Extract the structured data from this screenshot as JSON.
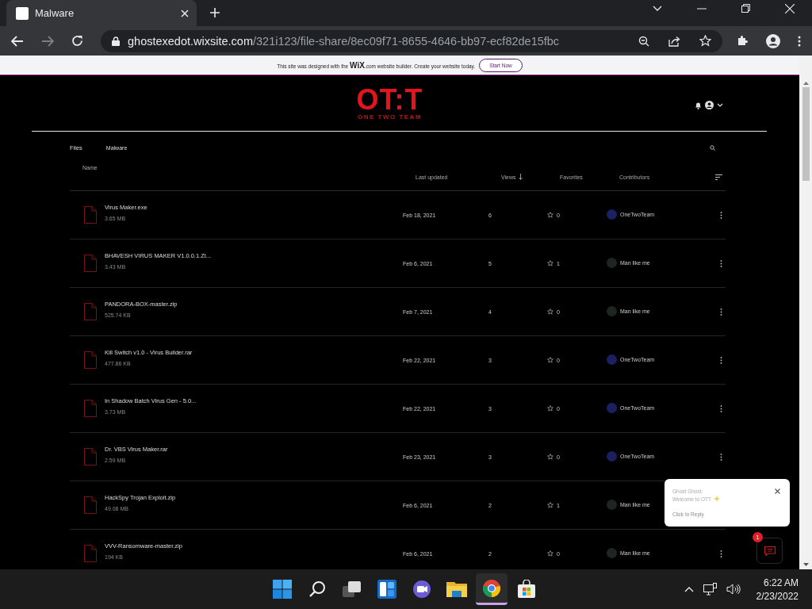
{
  "browser": {
    "tab": {
      "title": "Malware"
    },
    "address": {
      "domain": "ghostexedot.wixsite.com",
      "path": "/321i123/file-share/8ec09f71-8655-4646-bb97-ecf82de15fbc"
    }
  },
  "banner": {
    "text_before": "This site was designed with the",
    "brand": "WiX",
    "text_after": ".com website builder. Create your website today.",
    "button": "Start Now"
  },
  "site": {
    "logo": "OT:T",
    "logo_subtitle": "ONE TWO TEAM"
  },
  "files": {
    "breadcrumb": "Files",
    "folder": "Malware",
    "columns": [
      "Name",
      "Last updated",
      "Views",
      "Favorites",
      "Contributors"
    ],
    "rows": [
      {
        "name": "Virus Maker.exe",
        "size": "3.65 MB",
        "updated": "Feb 18, 2021",
        "views": "6",
        "favorites": "0",
        "contributor": {
          "name": "OneTwoTeam",
          "color": "#1b2060"
        }
      },
      {
        "name": "BHAVESH VIRUS MAKER V1.0.0.1.ZI...",
        "size": "3.43 MB",
        "updated": "Feb 6, 2021",
        "views": "5",
        "favorites": "1",
        "contributor": {
          "name": "Man like me",
          "color": "#1f2622"
        }
      },
      {
        "name": "PANDORA-BOX-master.zip",
        "size": "525.74 KB",
        "updated": "Feb 7, 2021",
        "views": "4",
        "favorites": "0",
        "contributor": {
          "name": "Man like me",
          "color": "#1f2622"
        }
      },
      {
        "name": "Kill Switch v1.0 - Virus Builder.rar",
        "size": "477.86 KB",
        "updated": "Feb 22, 2021",
        "views": "3",
        "favorites": "0",
        "contributor": {
          "name": "OneTwoTeam",
          "color": "#1b2060"
        }
      },
      {
        "name": "In Shadow Batch Virus Gen - 5.0...",
        "size": "3.73 MB",
        "updated": "Feb 22, 2021",
        "views": "3",
        "favorites": "0",
        "contributor": {
          "name": "OneTwoTeam",
          "color": "#1b2060"
        }
      },
      {
        "name": "Dr. VBS Virus Maker.rar",
        "size": "2.59 MB",
        "updated": "Feb 23, 2021",
        "views": "3",
        "favorites": "0",
        "contributor": {
          "name": "OneTwoTeam",
          "color": "#1b2060"
        }
      },
      {
        "name": "HackSpy Trojan Exploit.zip",
        "size": "49.08 MB",
        "updated": "Feb 6, 2021",
        "views": "2",
        "favorites": "1",
        "contributor": {
          "name": "Man like me",
          "color": "#1f2622"
        }
      },
      {
        "name": "VVV-Ransomware-master.zip",
        "size": "194 KB",
        "updated": "Feb 6, 2021",
        "views": "2",
        "favorites": "0",
        "contributor": {
          "name": "Man like me",
          "color": "#1f2622"
        }
      }
    ]
  },
  "chat": {
    "sender": "Ghost Ghost:",
    "message": "Welcome to OTT",
    "reply": "Click to Reply",
    "unread": "1"
  },
  "taskbar": {
    "apps": [
      {
        "kind": "start",
        "selected": false
      },
      {
        "kind": "search",
        "selected": false
      },
      {
        "kind": "taskview",
        "selected": false
      },
      {
        "kind": "widgets",
        "selected": false
      },
      {
        "kind": "chat",
        "selected": false
      },
      {
        "kind": "explorer",
        "selected": false
      },
      {
        "kind": "chrome",
        "selected": true
      },
      {
        "kind": "store",
        "selected": false
      }
    ],
    "time": "6:22 AM",
    "date": "2/23/2022"
  }
}
